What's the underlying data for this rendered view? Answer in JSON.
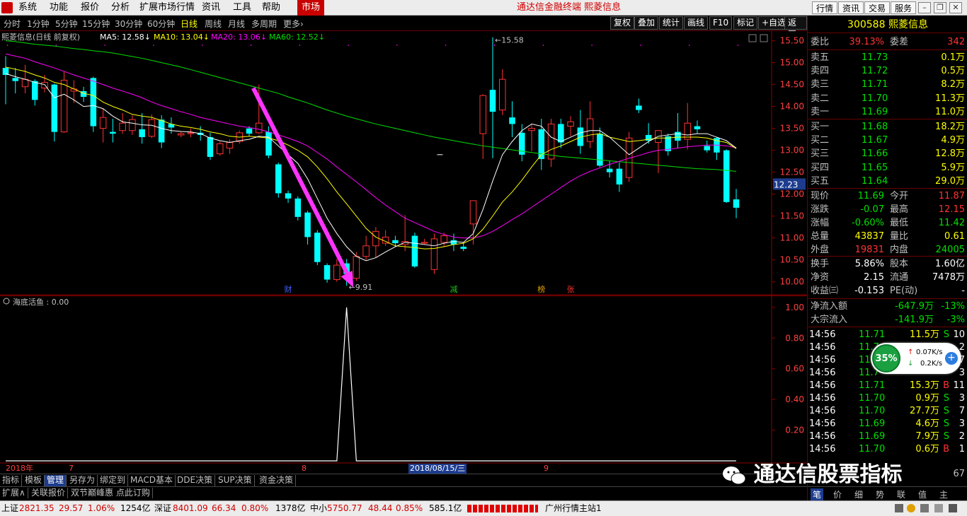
{
  "menubar": {
    "items": [
      "系统",
      "功能",
      "报价",
      "分析",
      "扩展市场行情",
      "资讯",
      "工具",
      "帮助"
    ],
    "market": "市场",
    "app_title": "通达信金融终端 熙菱信息",
    "right_buttons": [
      "行情",
      "资讯",
      "交易",
      "服务"
    ]
  },
  "periods": {
    "items": [
      "分时",
      "1分钟",
      "5分钟",
      "15分钟",
      "30分钟",
      "60分钟",
      "日线",
      "周线",
      "月线",
      "多周期",
      "更多›"
    ],
    "active": "日线",
    "tools": [
      "复权",
      "叠加",
      "统计",
      "画线",
      "F10",
      "标记",
      "+自选",
      "返回"
    ]
  },
  "chart_title": {
    "name": "熙菱信息(日线 前复权)",
    "ma5": "MA5: 12.58↓",
    "ma10": "MA10: 13.04↓",
    "ma20": "MA20: 13.06↓",
    "ma60": "MA60: 12.52↓"
  },
  "colors": {
    "up": "#ff3232",
    "down": "#00ffff",
    "ma5": "#ffffff",
    "ma10": "#ffff00",
    "ma20": "#ff00ff",
    "ma60": "#00e000",
    "arrow": "#ff33ff",
    "bg": "#000000",
    "border": "#8b0000"
  },
  "chart_data": [
    {
      "type": "candlestick",
      "title": "熙菱信息(日线 前复权)",
      "y_ticks": [
        "15.50",
        "15.00",
        "14.50",
        "14.00",
        "13.50",
        "13.00",
        "12.50",
        "12.00",
        "11.50",
        "11.00",
        "10.50",
        "10.00"
      ],
      "ylim": [
        9.72,
        15.72
      ],
      "current_price_label": "12.23",
      "high_annotation": "15.58",
      "low_annotation": "9.91",
      "event_markers": [
        {
          "index": 29,
          "label": "财"
        },
        {
          "index": 46,
          "label": "减"
        },
        {
          "index": 55,
          "label": "榜"
        },
        {
          "index": 58,
          "label": "张"
        }
      ],
      "candles": [
        {
          "o": 14.88,
          "h": 15.15,
          "l": 14.05,
          "c": 14.72
        },
        {
          "o": 14.65,
          "h": 14.88,
          "l": 14.3,
          "c": 14.58
        },
        {
          "o": 14.45,
          "h": 14.95,
          "l": 14.3,
          "c": 14.62
        },
        {
          "o": 14.58,
          "h": 14.62,
          "l": 14.02,
          "c": 14.15
        },
        {
          "o": 14.42,
          "h": 14.72,
          "l": 14.32,
          "c": 14.55
        },
        {
          "o": 14.5,
          "h": 14.52,
          "l": 13.2,
          "c": 13.42
        },
        {
          "o": 13.42,
          "h": 14.8,
          "l": 13.4,
          "c": 14.6
        },
        {
          "o": 14.35,
          "h": 14.6,
          "l": 14.08,
          "c": 14.4
        },
        {
          "o": 14.35,
          "h": 14.45,
          "l": 14.1,
          "c": 14.22
        },
        {
          "o": 14.65,
          "h": 14.68,
          "l": 13.42,
          "c": 13.55
        },
        {
          "o": 13.5,
          "h": 13.95,
          "l": 13.18,
          "c": 13.75
        },
        {
          "o": 13.42,
          "h": 13.72,
          "l": 13.18,
          "c": 13.38
        },
        {
          "o": 13.45,
          "h": 13.85,
          "l": 13.38,
          "c": 13.62
        },
        {
          "o": 13.45,
          "h": 13.8,
          "l": 13.35,
          "c": 13.7
        },
        {
          "o": 13.48,
          "h": 13.85,
          "l": 13.15,
          "c": 13.3
        },
        {
          "o": 13.32,
          "h": 13.82,
          "l": 13.28,
          "c": 13.7
        },
        {
          "o": 13.7,
          "h": 13.8,
          "l": 13.05,
          "c": 13.18
        },
        {
          "o": 13.6,
          "h": 13.75,
          "l": 13.38,
          "c": 13.52
        },
        {
          "o": 13.35,
          "h": 13.42,
          "l": 13.3,
          "c": 13.38
        },
        {
          "o": 13.38,
          "h": 13.5,
          "l": 13.3,
          "c": 13.4
        },
        {
          "o": 13.4,
          "h": 13.55,
          "l": 13.22,
          "c": 13.35
        },
        {
          "o": 13.3,
          "h": 13.4,
          "l": 12.78,
          "c": 12.85
        },
        {
          "o": 12.92,
          "h": 13.2,
          "l": 12.88,
          "c": 13.15
        },
        {
          "o": 13.05,
          "h": 13.25,
          "l": 12.92,
          "c": 13.18
        },
        {
          "o": 13.2,
          "h": 13.45,
          "l": 13.15,
          "c": 13.4
        },
        {
          "o": 13.5,
          "h": 13.55,
          "l": 13.32,
          "c": 13.38
        },
        {
          "o": 13.4,
          "h": 14.5,
          "l": 13.38,
          "c": 13.62
        },
        {
          "o": 13.42,
          "h": 13.55,
          "l": 12.82,
          "c": 12.88
        },
        {
          "o": 12.68,
          "h": 12.72,
          "l": 11.92,
          "c": 12.02
        },
        {
          "o": 12.02,
          "h": 12.08,
          "l": 11.8,
          "c": 11.9
        },
        {
          "o": 11.9,
          "h": 11.95,
          "l": 11.4,
          "c": 11.48
        },
        {
          "o": 11.58,
          "h": 11.62,
          "l": 10.85,
          "c": 11.02
        },
        {
          "o": 11.12,
          "h": 11.18,
          "l": 10.38,
          "c": 10.45
        },
        {
          "o": 10.38,
          "h": 10.42,
          "l": 9.98,
          "c": 10.05
        },
        {
          "o": 10.05,
          "h": 10.52,
          "l": 10.0,
          "c": 10.38
        },
        {
          "o": 10.42,
          "h": 10.52,
          "l": 9.91,
          "c": 10.18
        },
        {
          "o": 10.08,
          "h": 10.68,
          "l": 10.02,
          "c": 10.58
        },
        {
          "o": 10.58,
          "h": 11.05,
          "l": 10.5,
          "c": 10.82
        },
        {
          "o": 10.82,
          "h": 11.25,
          "l": 10.55,
          "c": 11.15
        },
        {
          "o": 10.88,
          "h": 11.18,
          "l": 10.82,
          "c": 11.02
        },
        {
          "o": 10.95,
          "h": 11.05,
          "l": 10.8,
          "c": 10.88
        },
        {
          "o": 10.85,
          "h": 11.52,
          "l": 10.7,
          "c": 10.92
        },
        {
          "o": 11.05,
          "h": 11.12,
          "l": 10.32,
          "c": 10.35
        },
        {
          "o": 10.88,
          "h": 10.98,
          "l": 10.85,
          "c": 10.9
        },
        {
          "o": 10.28,
          "h": 11.1,
          "l": 10.18,
          "c": 10.98
        },
        {
          "o": 10.9,
          "h": 11.12,
          "l": 10.8,
          "c": 11.05
        },
        {
          "o": 10.95,
          "h": 11.1,
          "l": 10.7,
          "c": 10.85
        },
        {
          "o": 10.8,
          "h": 10.9,
          "l": 10.7,
          "c": 10.75
        },
        {
          "o": 11.32,
          "h": 11.85,
          "l": 10.85,
          "c": 11.85
        },
        {
          "o": 13.38,
          "h": 14.28,
          "l": 12.8,
          "c": 14.25
        },
        {
          "o": 14.38,
          "h": 15.58,
          "l": 12.82,
          "c": 13.88
        },
        {
          "o": 13.92,
          "h": 14.85,
          "l": 13.8,
          "c": 14.62
        },
        {
          "o": 13.75,
          "h": 14.12,
          "l": 13.3,
          "c": 13.6
        },
        {
          "o": 13.4,
          "h": 13.6,
          "l": 12.75,
          "c": 12.9
        },
        {
          "o": 13.45,
          "h": 13.58,
          "l": 12.98,
          "c": 13.5
        },
        {
          "o": 13.48,
          "h": 13.72,
          "l": 12.55,
          "c": 12.8
        },
        {
          "o": 12.8,
          "h": 13.72,
          "l": 12.62,
          "c": 13.6
        },
        {
          "o": 13.6,
          "h": 13.72,
          "l": 13.05,
          "c": 13.18
        },
        {
          "o": 13.55,
          "h": 13.78,
          "l": 13.32,
          "c": 13.65
        },
        {
          "o": 13.52,
          "h": 13.92,
          "l": 12.92,
          "c": 13.1
        },
        {
          "o": 13.2,
          "h": 14.12,
          "l": 13.05,
          "c": 13.72
        },
        {
          "o": 13.38,
          "h": 13.52,
          "l": 12.62,
          "c": 12.65
        },
        {
          "o": 12.58,
          "h": 12.75,
          "l": 12.38,
          "c": 12.5
        },
        {
          "o": 12.58,
          "h": 12.72,
          "l": 12.05,
          "c": 12.22
        },
        {
          "o": 12.38,
          "h": 13.42,
          "l": 12.28,
          "c": 13.28
        },
        {
          "o": 14.02,
          "h": 14.18,
          "l": 13.85,
          "c": 13.92
        },
        {
          "o": 13.35,
          "h": 13.62,
          "l": 13.15,
          "c": 13.22
        },
        {
          "o": 13.18,
          "h": 13.45,
          "l": 12.48,
          "c": 13.45
        },
        {
          "o": 13.32,
          "h": 13.38,
          "l": 12.88,
          "c": 12.98
        },
        {
          "o": 13.42,
          "h": 13.85,
          "l": 13.05,
          "c": 13.22
        },
        {
          "o": 13.25,
          "h": 14.08,
          "l": 13.02,
          "c": 13.62
        },
        {
          "o": 13.55,
          "h": 13.68,
          "l": 13.38,
          "c": 13.48
        },
        {
          "o": 13.1,
          "h": 13.22,
          "l": 12.95,
          "c": 13.0
        },
        {
          "o": 13.28,
          "h": 13.3,
          "l": 12.78,
          "c": 12.95
        },
        {
          "o": 13.0,
          "h": 13.02,
          "l": 11.8,
          "c": 11.82
        },
        {
          "o": 11.88,
          "h": 12.12,
          "l": 11.45,
          "c": 11.69
        }
      ],
      "ma5": [
        14.75,
        14.68,
        14.62,
        14.55,
        14.5,
        14.2,
        14.28,
        14.15,
        14.0,
        14.02,
        13.95,
        13.78,
        13.65,
        13.62,
        13.58,
        13.57,
        13.5,
        13.45,
        13.43,
        13.42,
        13.38,
        13.28,
        13.22,
        13.18,
        13.22,
        13.25,
        13.32,
        13.3,
        13.1,
        12.9,
        12.7,
        12.35,
        11.9,
        11.45,
        11.1,
        10.8,
        10.58,
        10.48,
        10.55,
        10.68,
        10.8,
        10.9,
        10.88,
        10.85,
        10.82,
        10.88,
        10.92,
        10.9,
        11.1,
        11.65,
        12.3,
        12.9,
        13.2,
        13.45,
        13.6,
        13.55,
        13.3,
        13.2,
        13.3,
        13.4,
        13.45,
        13.45,
        13.3,
        13.1,
        12.9,
        13.05,
        13.2,
        13.32,
        13.35,
        13.38,
        13.35,
        13.38,
        13.38,
        13.3,
        13.22,
        13.05
      ],
      "ma10": [
        14.9,
        14.85,
        14.8,
        14.72,
        14.65,
        14.55,
        14.5,
        14.4,
        14.3,
        14.25,
        14.1,
        14.0,
        13.92,
        13.82,
        13.78,
        13.75,
        13.68,
        13.6,
        13.55,
        13.52,
        13.48,
        13.42,
        13.38,
        13.32,
        13.3,
        13.32,
        13.3,
        13.28,
        13.22,
        13.12,
        13.0,
        12.85,
        12.62,
        12.35,
        12.05,
        11.78,
        11.5,
        11.22,
        11.02,
        10.92,
        10.82,
        10.8,
        10.78,
        10.75,
        10.76,
        10.8,
        10.85,
        10.88,
        10.98,
        11.2,
        11.5,
        11.82,
        12.05,
        12.32,
        12.62,
        12.9,
        13.02,
        13.1,
        13.2,
        13.3,
        13.35,
        13.38,
        13.3,
        13.25,
        13.2,
        13.22,
        13.25,
        13.28,
        13.28,
        13.3,
        13.3,
        13.3,
        13.28,
        13.22,
        13.18,
        13.04
      ],
      "ma20": [
        15.2,
        15.15,
        15.1,
        15.02,
        14.95,
        14.88,
        14.8,
        14.72,
        14.65,
        14.58,
        14.5,
        14.42,
        14.35,
        14.28,
        14.2,
        14.1,
        14.02,
        13.95,
        13.88,
        13.82,
        13.75,
        13.7,
        13.65,
        13.6,
        13.55,
        13.52,
        13.48,
        13.42,
        13.35,
        13.28,
        13.2,
        13.1,
        12.95,
        12.8,
        12.62,
        12.45,
        12.28,
        12.1,
        11.92,
        11.75,
        11.6,
        11.45,
        11.35,
        11.25,
        11.15,
        11.08,
        11.02,
        11.0,
        11.0,
        11.05,
        11.15,
        11.28,
        11.42,
        11.55,
        11.7,
        11.85,
        12.0,
        12.15,
        12.3,
        12.42,
        12.52,
        12.6,
        12.68,
        12.75,
        12.82,
        12.88,
        12.95,
        13.0,
        13.02,
        13.05,
        13.08,
        13.1,
        13.12,
        13.12,
        13.1,
        13.06
      ],
      "ma60": [
        15.5,
        15.48,
        15.45,
        15.42,
        15.4,
        15.38,
        15.35,
        15.32,
        15.3,
        15.27,
        15.25,
        15.22,
        15.18,
        15.14,
        15.1,
        15.05,
        15.0,
        14.95,
        14.9,
        14.84,
        14.78,
        14.72,
        14.66,
        14.6,
        14.54,
        14.48,
        14.42,
        14.36,
        14.3,
        14.22,
        14.15,
        14.08,
        14.0,
        13.92,
        13.85,
        13.78,
        13.72,
        13.66,
        13.6,
        13.55,
        13.5,
        13.45,
        13.4,
        13.35,
        13.3,
        13.26,
        13.22,
        13.18,
        13.14,
        13.1,
        13.07,
        13.04,
        13.01,
        12.98,
        12.95,
        12.92,
        12.89,
        12.86,
        12.84,
        12.82,
        12.8,
        12.78,
        12.76,
        12.74,
        12.72,
        12.7,
        12.68,
        12.66,
        12.64,
        12.62,
        12.6,
        12.58,
        12.57,
        12.56,
        12.54,
        12.52
      ]
    },
    {
      "type": "line",
      "title": "海底活鱼 : 0.00",
      "y_ticks": [
        "1.00",
        "0.80",
        "0.60",
        "0.40",
        "0.20"
      ],
      "ylim": [
        0,
        1.05
      ],
      "values_note_index": 35,
      "values": [
        0,
        0,
        0,
        0,
        0,
        0,
        0,
        0,
        0,
        0,
        0,
        0,
        0,
        0,
        0,
        0,
        0,
        0,
        0,
        0,
        0,
        0,
        0,
        0,
        0,
        0,
        0,
        0,
        0,
        0,
        0,
        0,
        0,
        0,
        0,
        1,
        0,
        0,
        0,
        0,
        0,
        0,
        0,
        0,
        0,
        0,
        0,
        0,
        0,
        0,
        0,
        0,
        0,
        0,
        0,
        0,
        0,
        0,
        0,
        0,
        0,
        0,
        0,
        0,
        0,
        0,
        0,
        0,
        0,
        0,
        0,
        0,
        0,
        0,
        0,
        0
      ]
    }
  ],
  "indicator_title": "海底活鱼 : 0.00",
  "datebar": {
    "year": "2018年",
    "m7": "7",
    "m8": "8",
    "cursor_date": "2018/08/15/三",
    "m9": "9"
  },
  "tabs1": [
    "指标",
    "模板",
    "管理",
    "另存为",
    "绑定到",
    "MACD基本",
    "DDE决策",
    "SUP决策",
    "资金决策"
  ],
  "tabs1_active": "管理",
  "tabs2": [
    "扩展∧",
    "关联报价",
    "双节巅峰惠 点此订购"
  ],
  "status": {
    "sh_label": "上证",
    "sh_val": "2821.35",
    "sh_chg": "29.57",
    "sh_pct": "1.06%",
    "sh_amt": "1254亿",
    "sz_label": "深证",
    "sz_val": "8401.09",
    "sz_chg": "66.34",
    "sz_pct": "0.80%",
    "sz_amt": "1378亿",
    "zx_label": "中小",
    "zx_val": "5750.77",
    "zx_chg": "48.44",
    "zx_pct": "0.85%",
    "zx_amt": "585.1亿",
    "server": "广州行情主站1"
  },
  "quote": {
    "code_name": "300588 熙菱信息",
    "wb_label": "委比",
    "wb": "39.13%",
    "wc_label": "委差",
    "wc": "342",
    "asks": [
      {
        "l": "卖五",
        "p": "11.73",
        "v": "0.1万"
      },
      {
        "l": "卖四",
        "p": "11.72",
        "v": "0.5万"
      },
      {
        "l": "卖三",
        "p": "11.71",
        "v": "8.2万"
      },
      {
        "l": "卖二",
        "p": "11.70",
        "v": "11.3万"
      },
      {
        "l": "卖一",
        "p": "11.69",
        "v": "11.0万"
      }
    ],
    "bids": [
      {
        "l": "买一",
        "p": "11.68",
        "v": "18.2万"
      },
      {
        "l": "买二",
        "p": "11.67",
        "v": "4.9万"
      },
      {
        "l": "买三",
        "p": "11.66",
        "v": "12.8万"
      },
      {
        "l": "买四",
        "p": "11.65",
        "v": "5.9万"
      },
      {
        "l": "买五",
        "p": "11.64",
        "v": "29.0万"
      }
    ],
    "stats": [
      {
        "l1": "现价",
        "v1": "11.69",
        "c1": "grn",
        "l2": "今开",
        "v2": "11.87",
        "c2": "red"
      },
      {
        "l1": "涨跌",
        "v1": "-0.07",
        "c1": "grn",
        "l2": "最高",
        "v2": "12.15",
        "c2": "red"
      },
      {
        "l1": "涨幅",
        "v1": "-0.60%",
        "c1": "grn",
        "l2": "最低",
        "v2": "11.42",
        "c2": "grn"
      },
      {
        "l1": "总量",
        "v1": "43837",
        "c1": "yel",
        "l2": "量比",
        "v2": "0.61",
        "c2": "yel"
      },
      {
        "l1": "外盘",
        "v1": "19831",
        "c1": "red",
        "l2": "内盘",
        "v2": "24005",
        "c2": "grn"
      }
    ],
    "stats2": [
      {
        "l1": "换手",
        "v1": "5.86%",
        "l2": "股本",
        "v2": "1.60亿"
      },
      {
        "l1": "净资",
        "v1": "2.15",
        "l2": "流通",
        "v2": "7478万"
      },
      {
        "l1": "收益㈢",
        "v1": "-0.153",
        "l2": "PE(动)",
        "v2": "-"
      }
    ],
    "flow": [
      {
        "l": "净流入额",
        "v": "-647.9万",
        "p": "-13%"
      },
      {
        "l": "大宗流入",
        "v": "-141.9万",
        "p": "-3%"
      }
    ],
    "ticks": [
      {
        "t": "14:56",
        "p": "11.71",
        "v": "11.5万",
        "d": "S",
        "n": "10"
      },
      {
        "t": "14:56",
        "p": "11.7",
        "v": "",
        "d": "",
        "n": "2"
      },
      {
        "t": "14:56",
        "p": "11",
        "v": "",
        "d": "",
        "n": "7"
      },
      {
        "t": "14:56",
        "p": "11.7",
        "v": "",
        "d": "",
        "n": "3"
      },
      {
        "t": "14:56",
        "p": "11.71",
        "v": "15.3万",
        "d": "B",
        "n": "11"
      },
      {
        "t": "14:56",
        "p": "11.70",
        "v": "0.9万",
        "d": "S",
        "n": "3"
      },
      {
        "t": "14:56",
        "p": "11.70",
        "v": "27.7万",
        "d": "S",
        "n": "7"
      },
      {
        "t": "14:56",
        "p": "11.69",
        "v": "4.6万",
        "d": "S",
        "n": "3"
      },
      {
        "t": "14:56",
        "p": "11.69",
        "v": "7.9万",
        "d": "S",
        "n": "2"
      },
      {
        "t": "14:56",
        "p": "11.70",
        "v": "0.6万",
        "d": "B",
        "n": "1"
      }
    ],
    "last_count": "67",
    "rtabs": [
      "笔",
      "价",
      "细",
      "势",
      "联",
      "值",
      "主"
    ]
  },
  "netwidget": {
    "pct": "35%",
    "up": "0.07K/s",
    "down": "0.2K/s"
  },
  "watermark": "通达信股票指标"
}
